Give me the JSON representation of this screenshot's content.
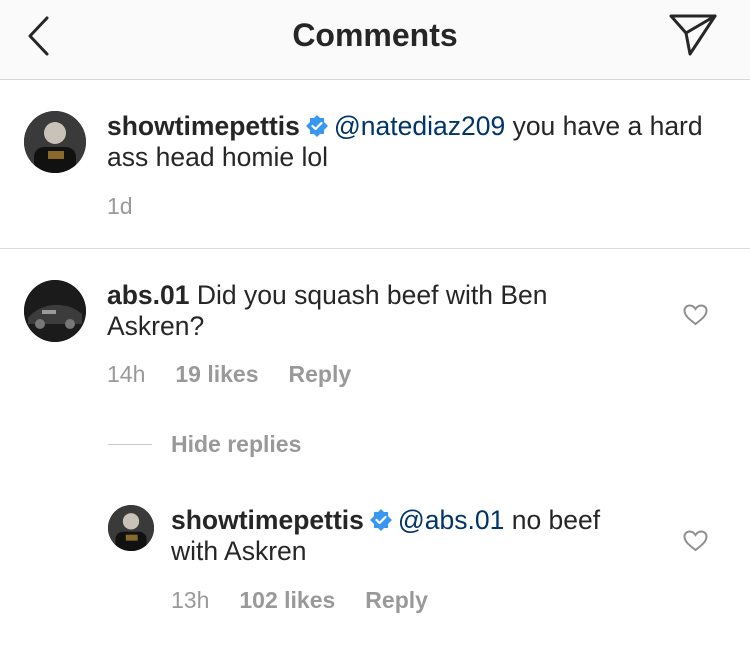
{
  "header": {
    "title": "Comments",
    "back_icon": "chevron-left-icon",
    "send_icon": "paper-plane-icon"
  },
  "comments": [
    {
      "username": "showtimepettis",
      "verified": true,
      "mention": "@natediaz209",
      "text": " you have a hard ass head homie lol",
      "time": "1d"
    },
    {
      "username": "abs.01",
      "verified": false,
      "text": "Did you squash beef with Ben Askren?",
      "time": "14h",
      "likes": "19 likes",
      "reply_label": "Reply",
      "hide_replies_label": "Hide replies"
    }
  ],
  "replies": [
    {
      "username": "showtimepettis",
      "verified": true,
      "mention": "@abs.01",
      "text": " no beef with Askren",
      "time": "13h",
      "likes": "102 likes",
      "reply_label": "Reply"
    }
  ],
  "colors": {
    "mention": "#003569",
    "verified": "#3897f0",
    "meta": "#999999",
    "header_bg": "#fafafa"
  }
}
